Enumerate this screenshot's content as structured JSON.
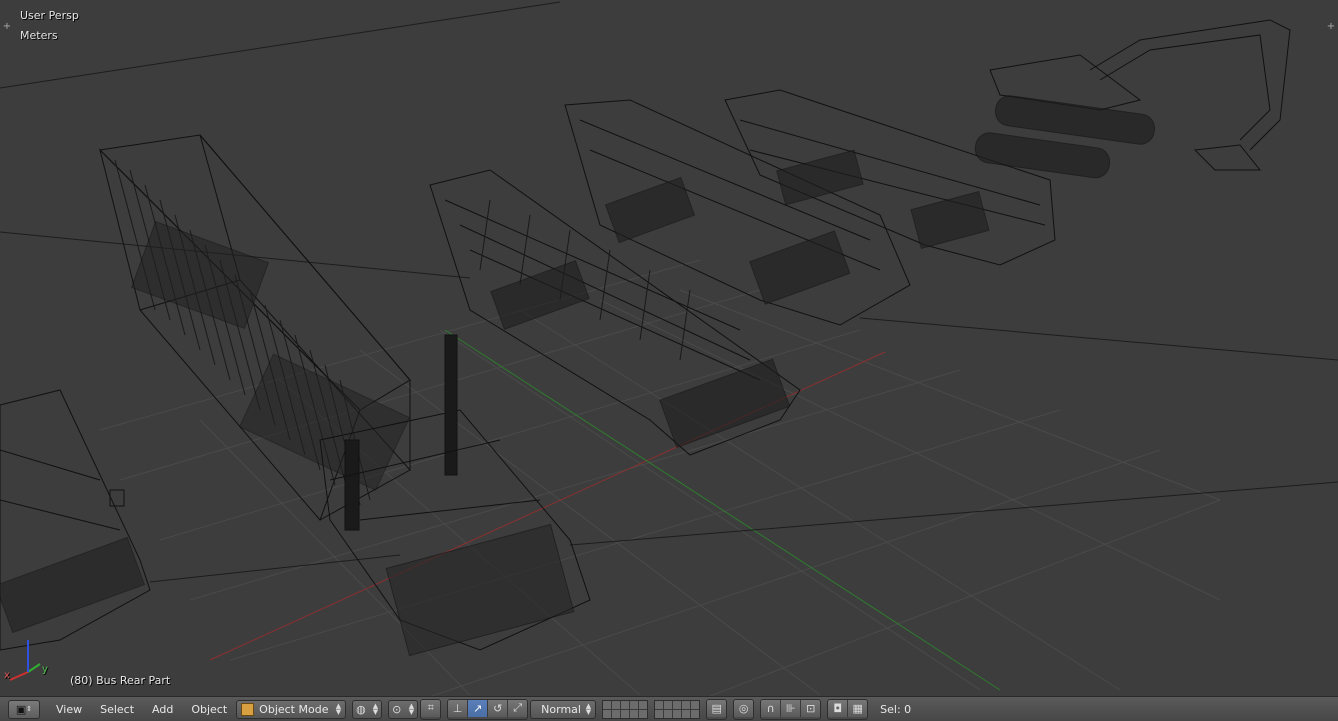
{
  "viewport": {
    "view_name": "User Persp",
    "units": "Meters",
    "selected_object": "(80) Bus Rear Part",
    "axis_labels": {
      "x": "x",
      "y": "y",
      "z": "z"
    }
  },
  "header": {
    "editor_icon": "3d-view-icon",
    "menus": [
      {
        "label": "View"
      },
      {
        "label": "Select"
      },
      {
        "label": "Add"
      },
      {
        "label": "Object"
      }
    ],
    "mode": {
      "label": "Object Mode",
      "icon": "cube-icon"
    },
    "shading_icon": "sphere-icon",
    "pivot_icon": "pivot-icon",
    "orientation": {
      "label": "Normal"
    },
    "status": "Sel: 0",
    "colors": {
      "active_button": "#4a6ea5",
      "header_bg": "#4e4e4e",
      "viewport_bg": "#3d3d3d"
    }
  }
}
